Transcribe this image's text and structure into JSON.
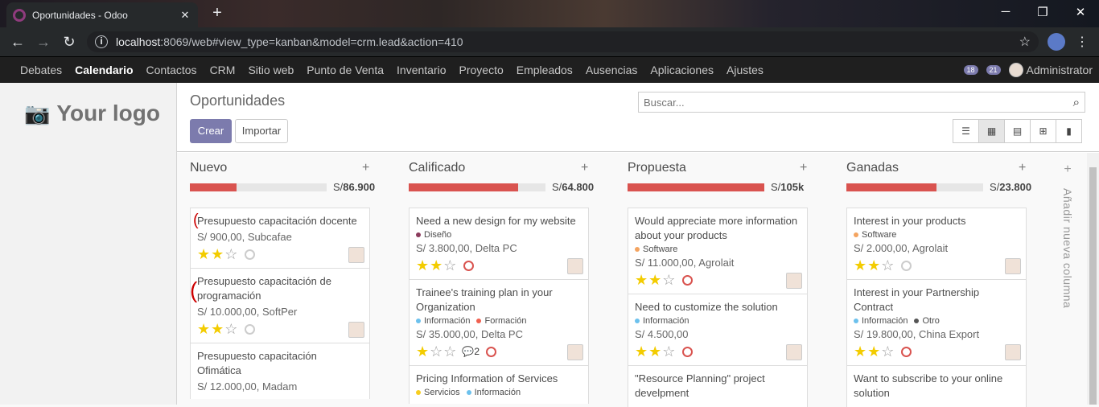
{
  "browser": {
    "tab_title": "Oportunidades - Odoo",
    "url_host": "localhost",
    "url_rest": ":8069/web#view_type=kanban&model=crm.lead&action=410"
  },
  "odoo_menu": [
    "Debates",
    "Calendario",
    "Contactos",
    "CRM",
    "Sitio web",
    "Punto de Venta",
    "Inventario",
    "Proyecto",
    "Empleados",
    "Ausencias",
    "Aplicaciones",
    "Ajustes"
  ],
  "odoo_menu_active": "Calendario",
  "nav_right": {
    "messages_count": "18",
    "chat_count": "21",
    "user": "Administrator"
  },
  "sidebar": {
    "logo_text": "Your logo"
  },
  "control_panel": {
    "breadcrumb": "Oportunidades",
    "create_label": "Crear",
    "import_label": "Importar",
    "search_placeholder": "Buscar..."
  },
  "add_column_label": "Añadir nueva columna",
  "columns": [
    {
      "title": "Nuevo",
      "progress": 0.34,
      "total_prefix": "S/",
      "total": "86.900",
      "cards": [
        {
          "title": "Presupuesto capacitación docente",
          "tags": [],
          "amount": "S/ 900,00, Subcafae",
          "stars": 2,
          "activity": "grey",
          "comments": ""
        },
        {
          "title": "Presupuesto capacitación de programación",
          "tags": [],
          "amount": "S/ 10.000,00, SoftPer",
          "stars": 2,
          "activity": "grey",
          "comments": ""
        },
        {
          "title": "Presupuesto capacitación Ofimática",
          "tags": [],
          "amount": "S/ 12.000,00, Madam",
          "stars": 0,
          "activity": "none",
          "comments": ""
        }
      ]
    },
    {
      "title": "Calificado",
      "progress": 0.8,
      "total_prefix": "S/",
      "total": "64.800",
      "cards": [
        {
          "title": "Need a new design for my website",
          "tags": [
            {
              "name": "Diseño",
              "color": "#8b3b5c"
            }
          ],
          "amount": "S/ 3.800,00, Delta PC",
          "stars": 2,
          "activity": "red",
          "comments": ""
        },
        {
          "title": "Trainee's training plan in your Organization",
          "tags": [
            {
              "name": "Información",
              "color": "#6cc1ed"
            },
            {
              "name": "Formación",
              "color": "#f06050"
            }
          ],
          "amount": "S/ 35.000,00, Delta PC",
          "stars": 1,
          "activity": "red",
          "comments": "2"
        },
        {
          "title": "Pricing Information of Services",
          "tags": [
            {
              "name": "Servicios",
              "color": "#f7cd1f"
            },
            {
              "name": "Información",
              "color": "#6cc1ed"
            }
          ],
          "amount": "",
          "stars": 0,
          "activity": "none",
          "comments": ""
        }
      ]
    },
    {
      "title": "Propuesta",
      "progress": 1.0,
      "total_prefix": "S/",
      "total": "105k",
      "cards": [
        {
          "title": "Would appreciate more information about your products",
          "tags": [
            {
              "name": "Software",
              "color": "#f4a460"
            }
          ],
          "amount": "S/ 11.000,00, Agrolait",
          "stars": 2,
          "activity": "red",
          "comments": ""
        },
        {
          "title": "Need to customize the solution",
          "tags": [
            {
              "name": "Información",
              "color": "#6cc1ed"
            }
          ],
          "amount": "S/ 4.500,00",
          "stars": 2,
          "activity": "red",
          "comments": ""
        },
        {
          "title": "\"Resource Planning\" project develpment",
          "tags": [],
          "amount": "",
          "stars": 0,
          "activity": "none",
          "comments": ""
        }
      ]
    },
    {
      "title": "Ganadas",
      "progress": 0.66,
      "total_prefix": "S/",
      "total": "23.800",
      "cards": [
        {
          "title": "Interest in your products",
          "tags": [
            {
              "name": "Software",
              "color": "#f4a460"
            }
          ],
          "amount": "S/ 2.000,00, Agrolait",
          "stars": 2,
          "activity": "grey",
          "comments": ""
        },
        {
          "title": "Interest in your Partnership Contract",
          "tags": [
            {
              "name": "Información",
              "color": "#6cc1ed"
            },
            {
              "name": "Otro",
              "color": "#555555"
            }
          ],
          "amount": "S/ 19.800,00, China Export",
          "stars": 2,
          "activity": "red",
          "comments": ""
        },
        {
          "title": "Want to subscribe to your online solution",
          "tags": [],
          "amount": "",
          "stars": 0,
          "activity": "none",
          "comments": ""
        }
      ]
    }
  ]
}
